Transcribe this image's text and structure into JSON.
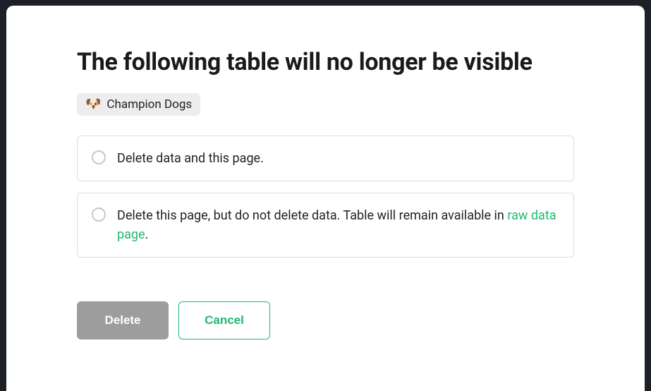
{
  "modal": {
    "title": "The following table will no longer be visible",
    "table": {
      "icon": "🐶",
      "name": "Champion Dogs"
    },
    "options": [
      {
        "text_before": "Delete data and this page.",
        "link_text": "",
        "text_after": ""
      },
      {
        "text_before": "Delete this page, but do not delete data. Table will remain available in ",
        "link_text": "raw data page",
        "text_after": "."
      }
    ],
    "buttons": {
      "delete": "Delete",
      "cancel": "Cancel"
    }
  }
}
